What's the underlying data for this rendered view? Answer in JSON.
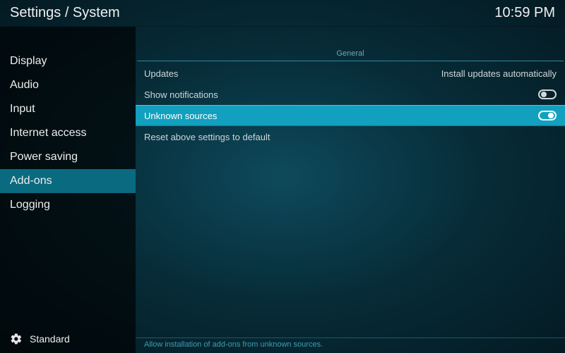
{
  "header": {
    "title": "Settings / System",
    "time": "10:59 PM"
  },
  "sidebar": {
    "items": [
      {
        "label": "Display",
        "active": false
      },
      {
        "label": "Audio",
        "active": false
      },
      {
        "label": "Input",
        "active": false
      },
      {
        "label": "Internet access",
        "active": false
      },
      {
        "label": "Power saving",
        "active": false
      },
      {
        "label": "Add-ons",
        "active": true
      },
      {
        "label": "Logging",
        "active": false
      }
    ],
    "level": "Standard"
  },
  "panel": {
    "section": "General",
    "rows": {
      "updates": {
        "label": "Updates",
        "value": "Install updates automatically"
      },
      "notifications": {
        "label": "Show notifications",
        "toggle": "off"
      },
      "unknown": {
        "label": "Unknown sources",
        "toggle": "on"
      },
      "reset": {
        "label": "Reset above settings to default"
      }
    },
    "hint": "Allow installation of add-ons from unknown sources."
  }
}
